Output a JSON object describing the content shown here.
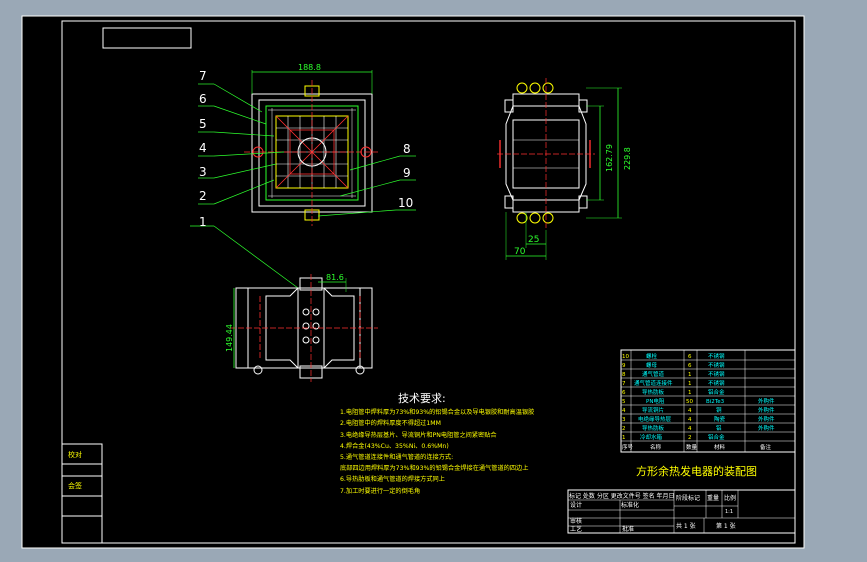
{
  "drawing": {
    "title": "方形余热发电器的装配图",
    "tech_req_title": "技术要求:",
    "tech_requirements": [
      "1.电阻管中焊料厚为73%和93%的铅锡合金以及导电银胶和耐高温银胶",
      "2.电阻管中的焊料厚度不得超过1MM",
      "3.电绝缘导热层基片、导流铜片和PN电阻管之间紧密贴合",
      "4.焊合金(43%Cu、35%Ni、0.6%Mn)",
      "5.通气管道连接件和通气管道的连接方式:",
      "  底部四边用焊料厚为73%和93%的铅锡合金焊接在通气管道的四边上",
      "6.导热肋板和通气管道的焊接方式同上",
      "7.加工时要进行一定的倒毛角"
    ],
    "part_numbers": [
      "7",
      "6",
      "5",
      "4",
      "3",
      "2",
      "1",
      "8",
      "9",
      "10"
    ],
    "dimensions": {
      "top_width": "188.8",
      "side_height1": "162.79",
      "side_height2": "229.8",
      "side_d25": "25",
      "side_d70": "70",
      "bottom_width": "81.6",
      "bottom_height": "149.44"
    },
    "side_labels": [
      "校对",
      "会签"
    ],
    "bom_rows": [
      {
        "no": "10",
        "name": "螺栓",
        "qty": "6",
        "mat": "不锈钢",
        "note": ""
      },
      {
        "no": "9",
        "name": "螺母",
        "qty": "6",
        "mat": "不锈钢",
        "note": ""
      },
      {
        "no": "8",
        "name": "通气管道",
        "qty": "1",
        "mat": "不锈钢",
        "note": ""
      },
      {
        "no": "7",
        "name": "通气管道连接件",
        "qty": "1",
        "mat": "不锈钢",
        "note": ""
      },
      {
        "no": "6",
        "name": "导热肋板",
        "qty": "1",
        "mat": "铝合金",
        "note": ""
      },
      {
        "no": "5",
        "name": "PN电阻",
        "qty": "50",
        "mat": "Bi2Te3",
        "note": "外购件"
      },
      {
        "no": "4",
        "name": "导流铜片",
        "qty": "4",
        "mat": "铜",
        "note": "外购件"
      },
      {
        "no": "3",
        "name": "电绝缘导热层",
        "qty": "4",
        "mat": "陶瓷",
        "note": "外购件"
      },
      {
        "no": "2",
        "name": "导热肋板",
        "qty": "4",
        "mat": "铝",
        "note": "外购件"
      },
      {
        "no": "1",
        "name": "冷却水箱",
        "qty": "2",
        "mat": "铝合金",
        "note": ""
      }
    ],
    "bom_header": {
      "no": "序号",
      "name": "名称",
      "qty": "数量",
      "mat": "材料",
      "note": "备注"
    },
    "title_block": {
      "row1": "标记 处数 分区 更改文件号 签名 年月日",
      "design": "设计",
      "standard": "标准化",
      "stage": "阶段标记",
      "weight": "重量",
      "scale": "比例",
      "scale_val": "1:1",
      "review": "审核",
      "process": "工艺",
      "approve": "批准",
      "sheets": "共 1 张",
      "sheet": "第 1 张"
    }
  },
  "colors": {
    "background": "#000000",
    "outer": "#9aa8b6",
    "line": "#ffffff",
    "dim": "#2dff2d",
    "part": "#ffff00",
    "center": "#ff3030"
  }
}
